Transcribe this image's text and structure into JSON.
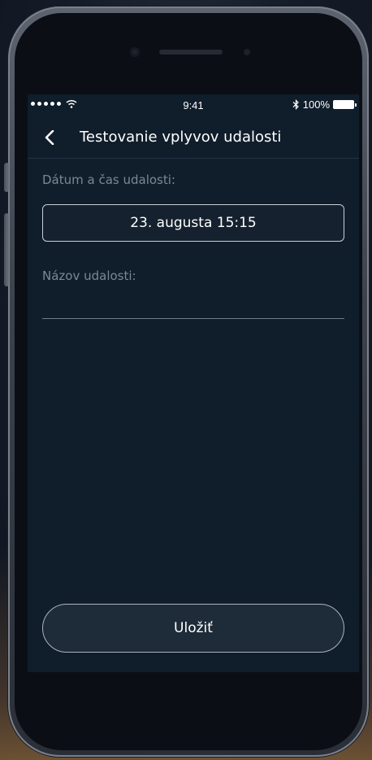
{
  "status_bar": {
    "time": "9:41",
    "battery": "100%",
    "icons": [
      "signal-dots-icon",
      "wifi-icon",
      "bluetooth-icon",
      "battery-icon"
    ]
  },
  "nav": {
    "title": "Testovanie vplyvov udalosti",
    "back_icon": "chevron-left-icon"
  },
  "form": {
    "datetime_label": "Dátum a čas udalosti:",
    "datetime_value": "23. augusta 15:15",
    "name_label": "Názov udalosti:",
    "name_value": "",
    "save_label": "Uložiť"
  },
  "colors": {
    "screen_bg": "#101d2b",
    "label": "#7b8896",
    "text": "#ffffff"
  }
}
